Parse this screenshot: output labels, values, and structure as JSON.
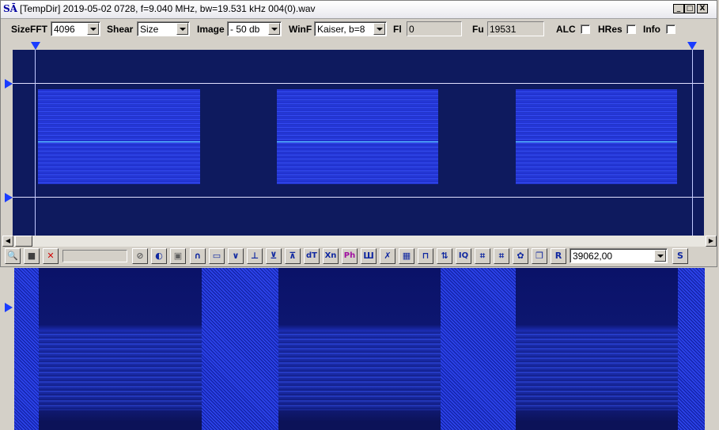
{
  "window": {
    "app_icon": "SĀ",
    "title": "[TempDir] 2019-05-02 0728, f=9.040 MHz, bw=19.531 kHz 004(0).wav",
    "minimize": "_",
    "maximize": "□",
    "close": "X"
  },
  "controls": {
    "sizefft_label": "SizeFFT",
    "sizefft_value": "4096",
    "shear_label": "Shear",
    "shear_value": "Size",
    "image_label": "Image",
    "image_value": "- 50 db",
    "winf_label": "WinF",
    "winf_value": "Kaiser, b=8",
    "fl_label": "Fl",
    "fl_value": "0",
    "fu_label": "Fu",
    "fu_value": "19531",
    "alc_label": "ALC",
    "hres_label": "HRes",
    "info_label": "Info"
  },
  "toolbar": {
    "buttons": [
      "zoom-icon",
      "folder-icon",
      "cancel-icon",
      "stop-icon",
      "speaker-icon",
      "stop-square-icon",
      "arc-icon",
      "rectangle-icon",
      "v-shape-icon",
      "filter-icon",
      "filter2-icon",
      "filter3-icon",
      "dT",
      "Xn",
      "Ph",
      "comb-icon",
      "cross-icon",
      "grid-icon",
      "square-wave-icon",
      "swap-icon",
      "IQ",
      "pattern1-icon",
      "pattern2-icon",
      "gear-icon",
      "copy-icon",
      "R"
    ],
    "dt_label": "dT",
    "xn_label": "Xn",
    "ph_label": "Ph",
    "iq_label": "IQ",
    "r_label": "R",
    "value_combo": "39062,00",
    "s_label": "S"
  },
  "colors": {
    "accent": "#1a3cff",
    "spectrum_bg": "#0e1a5e"
  }
}
